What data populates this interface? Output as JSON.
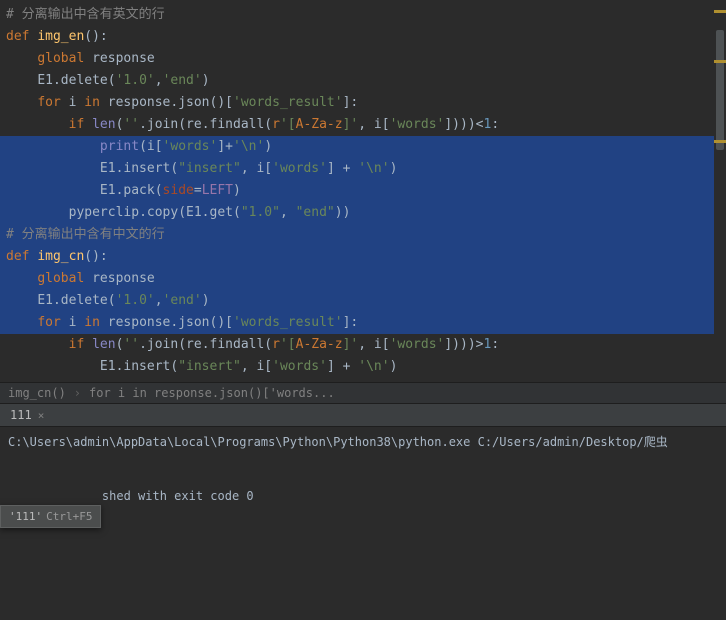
{
  "code": {
    "comment_en": "# 分离输出中含有英文的行",
    "def1_def": "def ",
    "def1_name": "img_en",
    "def1_paren": "():",
    "global": "global ",
    "response": "response",
    "e1delete_obj": "E1.delete(",
    "str_10": "'1.0'",
    "comma_sp": ",",
    "str_end": "'end'",
    "close_paren": ")",
    "for": "for ",
    "i": "i",
    "in": " in ",
    "response_json": "response.json()[",
    "str_words_result": "'words_result'",
    "bracket_colon": "]:",
    "if": "if ",
    "len": "len",
    "empty_str": "''",
    "join": ".join(re.findall(",
    "raw_r": "r",
    "regex_open": "'[",
    "regex_class": "A-Za-z",
    "regex_close": "]'",
    "i_words": "i[",
    "str_words": "'words'",
    "close4": "])))",
    "lt": "<",
    "one": "1",
    "colon": ":",
    "print": "print",
    "print_open": "(i[",
    "plus": "+",
    "newline": "'\\n'",
    "e1insert": "E1.insert(",
    "str_insert": "\"insert\"",
    "e1pack": "E1.pack(",
    "side": "side",
    "eq": "=",
    "left": "LEFT",
    "pyperclip": "pyperclip.copy(E1.get(",
    "str_10d": "\"1.0\"",
    "str_endd": "\"end\"",
    "close2": "))",
    "comment_cn": "# 分离输出中含有中文的行",
    "def2_name": "img_cn",
    "gt": ">"
  },
  "breadcrumb": {
    "item1": "img_cn()",
    "item2": "for i in response.json()['words..."
  },
  "console_tab": "111",
  "console": {
    "path": "C:\\Users\\admin\\AppData\\Local\\Programs\\Python\\Python38\\python.exe C:/Users/admin/Desktop/爬虫",
    "exit_partial": "shed with exit code 0"
  },
  "tooltip": {
    "label": "'111'",
    "shortcut": "Ctrl+F5"
  }
}
